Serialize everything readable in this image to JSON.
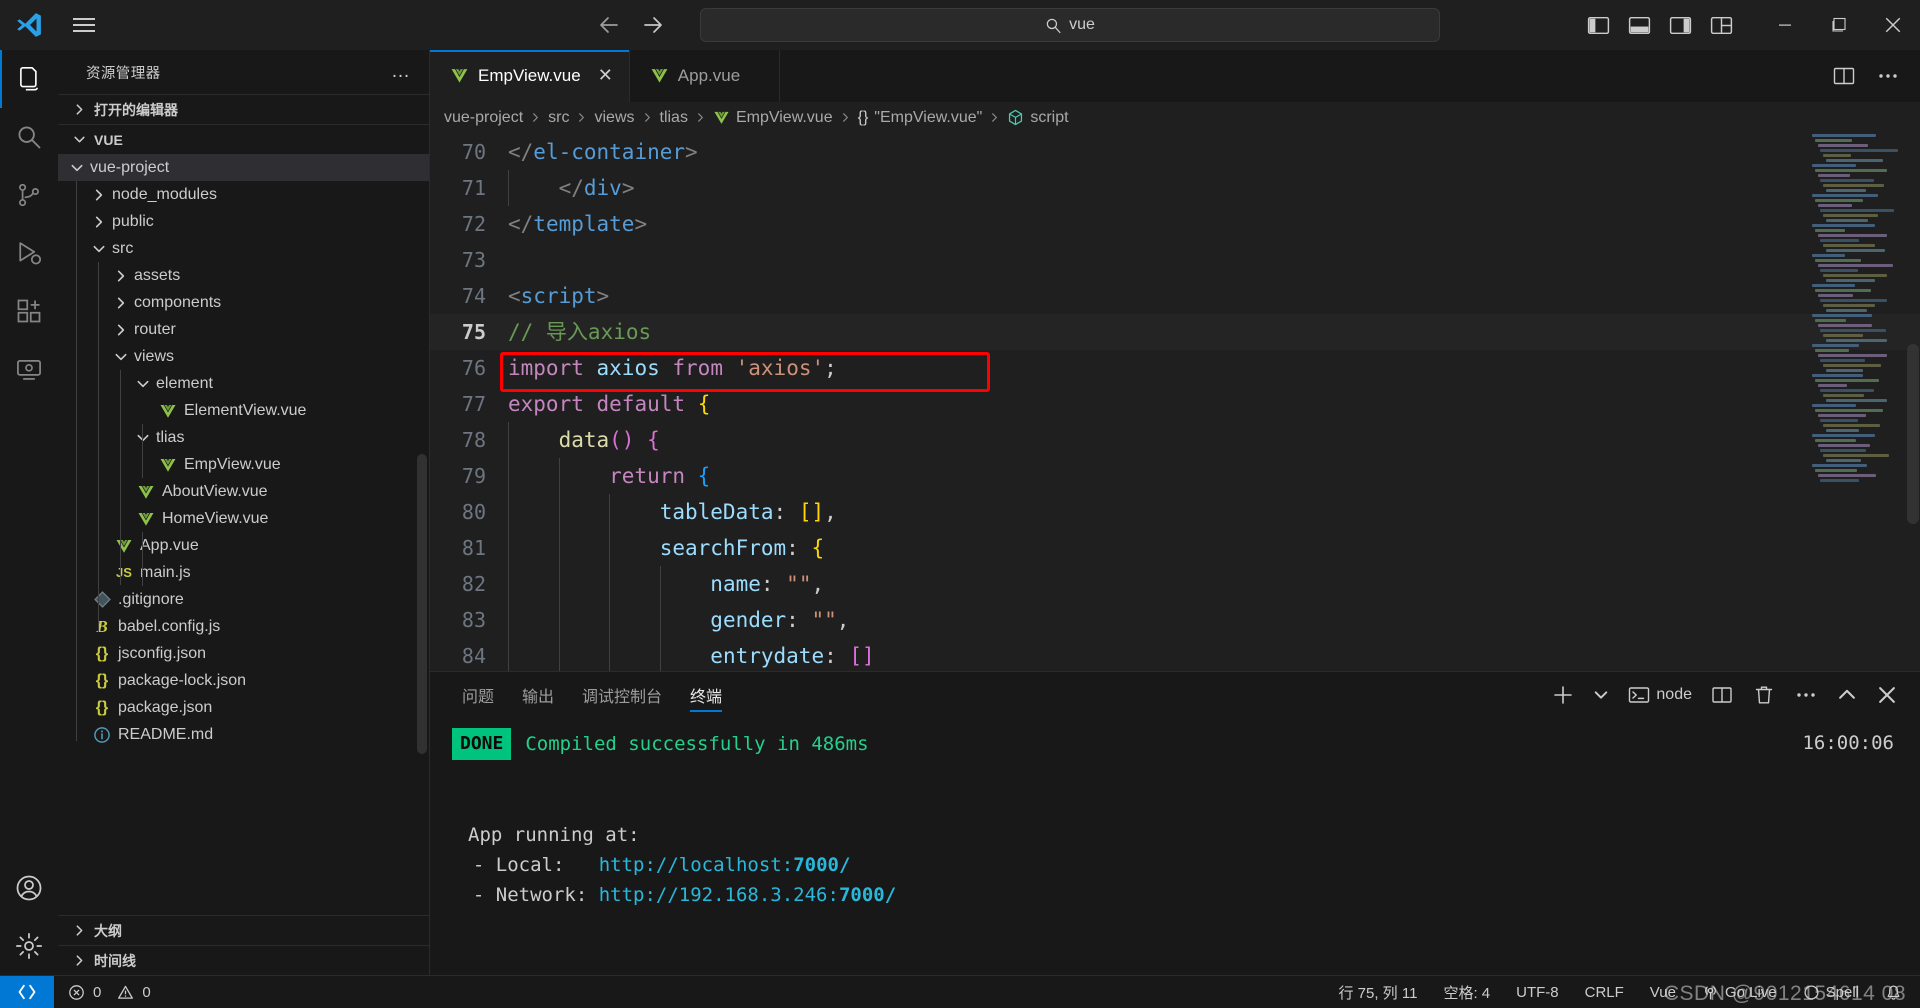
{
  "titlebar": {
    "logo": "vscode-logo-icon",
    "menu_label": "hamburger-menu-icon",
    "back_label": "back-arrow-icon",
    "forward_label": "forward-arrow-icon",
    "search_value": "vue",
    "search_icon": "search-icon",
    "layout_buttons": [
      {
        "name": "toggle-primary-sidebar",
        "icon": "panel-left-icon"
      },
      {
        "name": "toggle-panel",
        "icon": "panel-bottom-icon"
      },
      {
        "name": "toggle-secondary-sidebar",
        "icon": "panel-right-icon"
      },
      {
        "name": "customize-layout",
        "icon": "layout-grid-icon"
      }
    ],
    "window_buttons": [
      {
        "name": "minimize-button",
        "glyph": "─"
      },
      {
        "name": "maximize-button",
        "glyph": "❐"
      },
      {
        "name": "close-button",
        "glyph": "✕"
      }
    ]
  },
  "activitybar": {
    "items": [
      {
        "name": "explorer",
        "icon": "files-icon",
        "active": true
      },
      {
        "name": "search",
        "icon": "search-icon",
        "active": false
      },
      {
        "name": "source-control",
        "icon": "source-control-icon",
        "active": false
      },
      {
        "name": "run-and-debug",
        "icon": "debug-icon",
        "active": false
      },
      {
        "name": "extensions",
        "icon": "extensions-icon",
        "active": false
      },
      {
        "name": "remote-explorer",
        "icon": "remote-icon",
        "active": false
      }
    ],
    "bottom_items": [
      {
        "name": "accounts",
        "icon": "account-icon"
      },
      {
        "name": "manage-settings",
        "icon": "gear-icon"
      }
    ]
  },
  "sidebar": {
    "title": "资源管理器",
    "more_actions": "…",
    "open_editors_label": "打开的编辑器",
    "workspace_label": "VUE",
    "outline_label": "大纲",
    "timeline_label": "时间线",
    "tree": [
      {
        "label": "vue-project",
        "depth": 0,
        "kind": "folder",
        "expanded": true,
        "selected": true
      },
      {
        "label": "node_modules",
        "depth": 1,
        "kind": "folder",
        "expanded": false
      },
      {
        "label": "public",
        "depth": 1,
        "kind": "folder",
        "expanded": false
      },
      {
        "label": "src",
        "depth": 1,
        "kind": "folder",
        "expanded": true
      },
      {
        "label": "assets",
        "depth": 2,
        "kind": "folder",
        "expanded": false
      },
      {
        "label": "components",
        "depth": 2,
        "kind": "folder",
        "expanded": false
      },
      {
        "label": "router",
        "depth": 2,
        "kind": "folder",
        "expanded": false
      },
      {
        "label": "views",
        "depth": 2,
        "kind": "folder",
        "expanded": true
      },
      {
        "label": "element",
        "depth": 3,
        "kind": "folder",
        "expanded": true
      },
      {
        "label": "ElementView.vue",
        "depth": 4,
        "kind": "vue"
      },
      {
        "label": "tlias",
        "depth": 3,
        "kind": "folder",
        "expanded": true
      },
      {
        "label": "EmpView.vue",
        "depth": 4,
        "kind": "vue"
      },
      {
        "label": "AboutView.vue",
        "depth": 3,
        "kind": "vue"
      },
      {
        "label": "HomeView.vue",
        "depth": 3,
        "kind": "vue"
      },
      {
        "label": "App.vue",
        "depth": 2,
        "kind": "vue"
      },
      {
        "label": "main.js",
        "depth": 2,
        "kind": "js"
      },
      {
        "label": ".gitignore",
        "depth": 1,
        "kind": "git"
      },
      {
        "label": "babel.config.js",
        "depth": 1,
        "kind": "babel"
      },
      {
        "label": "jsconfig.json",
        "depth": 1,
        "kind": "json"
      },
      {
        "label": "package-lock.json",
        "depth": 1,
        "kind": "json"
      },
      {
        "label": "package.json",
        "depth": 1,
        "kind": "json"
      },
      {
        "label": "README.md",
        "depth": 1,
        "kind": "md"
      }
    ]
  },
  "editor": {
    "tabs": [
      {
        "label": "EmpView.vue",
        "icon": "vue-icon",
        "active": true,
        "close": "✕"
      },
      {
        "label": "App.vue",
        "icon": "vue-icon",
        "active": false
      }
    ],
    "tab_actions": [
      {
        "name": "split-editor-right",
        "icon": "split-editor-icon"
      },
      {
        "name": "editor-more-actions",
        "icon": "ellipsis-icon"
      }
    ],
    "breadcrumb": [
      {
        "label": "vue-project",
        "icon": ""
      },
      {
        "label": "src",
        "icon": ""
      },
      {
        "label": "views",
        "icon": ""
      },
      {
        "label": "tlias",
        "icon": ""
      },
      {
        "label": "EmpView.vue",
        "icon": "vue-icon"
      },
      {
        "label": "\"EmpView.vue\"",
        "icon": "json-braces-icon"
      },
      {
        "label": "script",
        "icon": "symbol-module-icon"
      }
    ],
    "first_line": 70,
    "current_line": 75,
    "code": [
      {
        "n": 70,
        "guides": 0,
        "tokens": [
          {
            "t": "</",
            "c": "t-punct"
          },
          {
            "t": "el-container",
            "c": "t-tag"
          },
          {
            "t": ">",
            "c": "t-punct"
          }
        ]
      },
      {
        "n": 71,
        "guides": 1,
        "tokens": [
          {
            "t": "    ",
            "c": "t-plain"
          },
          {
            "t": "</",
            "c": "t-punct"
          },
          {
            "t": "div",
            "c": "t-tag"
          },
          {
            "t": ">",
            "c": "t-punct"
          }
        ]
      },
      {
        "n": 72,
        "guides": 0,
        "tokens": [
          {
            "t": "</",
            "c": "t-punct"
          },
          {
            "t": "template",
            "c": "t-tag"
          },
          {
            "t": ">",
            "c": "t-punct"
          }
        ]
      },
      {
        "n": 73,
        "guides": 0,
        "tokens": []
      },
      {
        "n": 74,
        "guides": 0,
        "tokens": [
          {
            "t": "<",
            "c": "t-punct"
          },
          {
            "t": "script",
            "c": "t-tag"
          },
          {
            "t": ">",
            "c": "t-punct"
          }
        ]
      },
      {
        "n": 75,
        "guides": 0,
        "current": true,
        "tokens": [
          {
            "t": "// 导入axios",
            "c": "t-comment"
          }
        ]
      },
      {
        "n": 76,
        "guides": 0,
        "highlight": true,
        "tokens": [
          {
            "t": "import",
            "c": "t-kw"
          },
          {
            "t": " ",
            "c": "t-plain"
          },
          {
            "t": "axios",
            "c": "t-var"
          },
          {
            "t": " ",
            "c": "t-plain"
          },
          {
            "t": "from",
            "c": "t-kw"
          },
          {
            "t": " ",
            "c": "t-plain"
          },
          {
            "t": "'axios'",
            "c": "t-str"
          },
          {
            "t": ";",
            "c": "t-plain"
          }
        ]
      },
      {
        "n": 77,
        "guides": 0,
        "tokens": [
          {
            "t": "export",
            "c": "t-kw"
          },
          {
            "t": " ",
            "c": "t-plain"
          },
          {
            "t": "default",
            "c": "t-kw"
          },
          {
            "t": " ",
            "c": "t-plain"
          },
          {
            "t": "{",
            "c": "t-br-y"
          }
        ]
      },
      {
        "n": 78,
        "guides": 1,
        "tokens": [
          {
            "t": "    ",
            "c": "t-plain"
          },
          {
            "t": "data",
            "c": "t-fn"
          },
          {
            "t": "()",
            "c": "t-br-p"
          },
          {
            "t": " ",
            "c": "t-plain"
          },
          {
            "t": "{",
            "c": "t-br-p"
          }
        ]
      },
      {
        "n": 79,
        "guides": 2,
        "tokens": [
          {
            "t": "        ",
            "c": "t-plain"
          },
          {
            "t": "return",
            "c": "t-kw"
          },
          {
            "t": " ",
            "c": "t-plain"
          },
          {
            "t": "{",
            "c": "t-br-b"
          }
        ]
      },
      {
        "n": 80,
        "guides": 3,
        "tokens": [
          {
            "t": "            ",
            "c": "t-plain"
          },
          {
            "t": "tableData",
            "c": "t-var"
          },
          {
            "t": ": ",
            "c": "t-plain"
          },
          {
            "t": "[]",
            "c": "t-br-y"
          },
          {
            "t": ",",
            "c": "t-plain"
          }
        ]
      },
      {
        "n": 81,
        "guides": 3,
        "tokens": [
          {
            "t": "            ",
            "c": "t-plain"
          },
          {
            "t": "searchFrom",
            "c": "t-var"
          },
          {
            "t": ": ",
            "c": "t-plain"
          },
          {
            "t": "{",
            "c": "t-br-y"
          }
        ]
      },
      {
        "n": 82,
        "guides": 4,
        "tokens": [
          {
            "t": "                ",
            "c": "t-plain"
          },
          {
            "t": "name",
            "c": "t-var"
          },
          {
            "t": ": ",
            "c": "t-plain"
          },
          {
            "t": "\"\"",
            "c": "t-str"
          },
          {
            "t": ",",
            "c": "t-plain"
          }
        ]
      },
      {
        "n": 83,
        "guides": 4,
        "tokens": [
          {
            "t": "                ",
            "c": "t-plain"
          },
          {
            "t": "gender",
            "c": "t-var"
          },
          {
            "t": ": ",
            "c": "t-plain"
          },
          {
            "t": "\"\"",
            "c": "t-str"
          },
          {
            "t": ",",
            "c": "t-plain"
          }
        ]
      },
      {
        "n": 84,
        "guides": 4,
        "tokens": [
          {
            "t": "                ",
            "c": "t-plain"
          },
          {
            "t": "entrydate",
            "c": "t-var"
          },
          {
            "t": ": ",
            "c": "t-plain"
          },
          {
            "t": "[]",
            "c": "t-br-p"
          }
        ]
      }
    ]
  },
  "panel": {
    "tabs": [
      {
        "label": "问题",
        "active": false
      },
      {
        "label": "输出",
        "active": false
      },
      {
        "label": "调试控制台",
        "active": false
      },
      {
        "label": "终端",
        "active": true
      }
    ],
    "actions": [
      {
        "name": "new-terminal-button",
        "icon": "plus-icon"
      },
      {
        "name": "terminal-profile-dropdown",
        "icon": "chevron-down-icon"
      },
      {
        "name": "terminal-instance",
        "icon": "terminal-icon",
        "label": "node"
      },
      {
        "name": "split-terminal-button",
        "icon": "split-icon"
      },
      {
        "name": "kill-terminal-button",
        "icon": "trash-icon"
      },
      {
        "name": "panel-more-actions",
        "icon": "ellipsis-icon"
      },
      {
        "name": "maximize-panel-button",
        "icon": "chevron-up-icon"
      },
      {
        "name": "close-panel-button",
        "icon": "close-icon"
      }
    ],
    "terminal": {
      "badge": "DONE",
      "status_text": "Compiled successfully in 486ms",
      "timestamp": "16:00:06",
      "running_title": "App running at:",
      "local_label": "  - Local:   ",
      "local_url_prefix": "http://localhost:",
      "local_url_port": "7000/",
      "network_label": "  - Network: ",
      "network_url_prefix": "http://192.168.3.246:",
      "network_url_port": "7000/"
    }
  },
  "statusbar": {
    "remote_icon": "remote-window-icon",
    "errors": "0",
    "warnings": "0",
    "cursor_position": "行 75, 列 11",
    "indentation": "空格: 4",
    "encoding": "UTF-8",
    "eol": "CRLF",
    "language": "Vue",
    "go_live": "Go Live",
    "spell": "Spell",
    "notifications_icon": "bell-icon",
    "watermark": "CSDN @9012154614 08"
  },
  "colors": {
    "accent": "#0078d4",
    "vue_green": "#8dc149",
    "terminal_green": "#23d18b",
    "highlight_red": "#ff0000",
    "done_badge": "#00c47e"
  }
}
